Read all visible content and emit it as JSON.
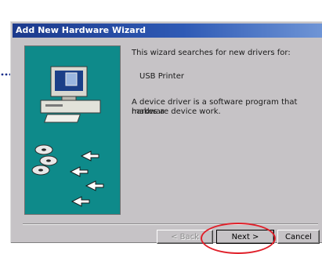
{
  "window": {
    "title": "Add New Hardware Wizard"
  },
  "content": {
    "line1": "This wizard searches for new drivers for:",
    "device_name": "USB Printer",
    "description_line1": "A device driver is a software program that makes a",
    "description_line2": "hardware device work."
  },
  "buttons": {
    "back_label": "< Back",
    "next_label": "Next >",
    "cancel_label": "Cancel"
  },
  "colors": {
    "title_bar": "#1c3a8c",
    "panel": "#0e8a8a",
    "highlight": "#e0202a"
  },
  "icons": [
    "computer-icon",
    "cd-disc-icon",
    "arrow-icon"
  ]
}
